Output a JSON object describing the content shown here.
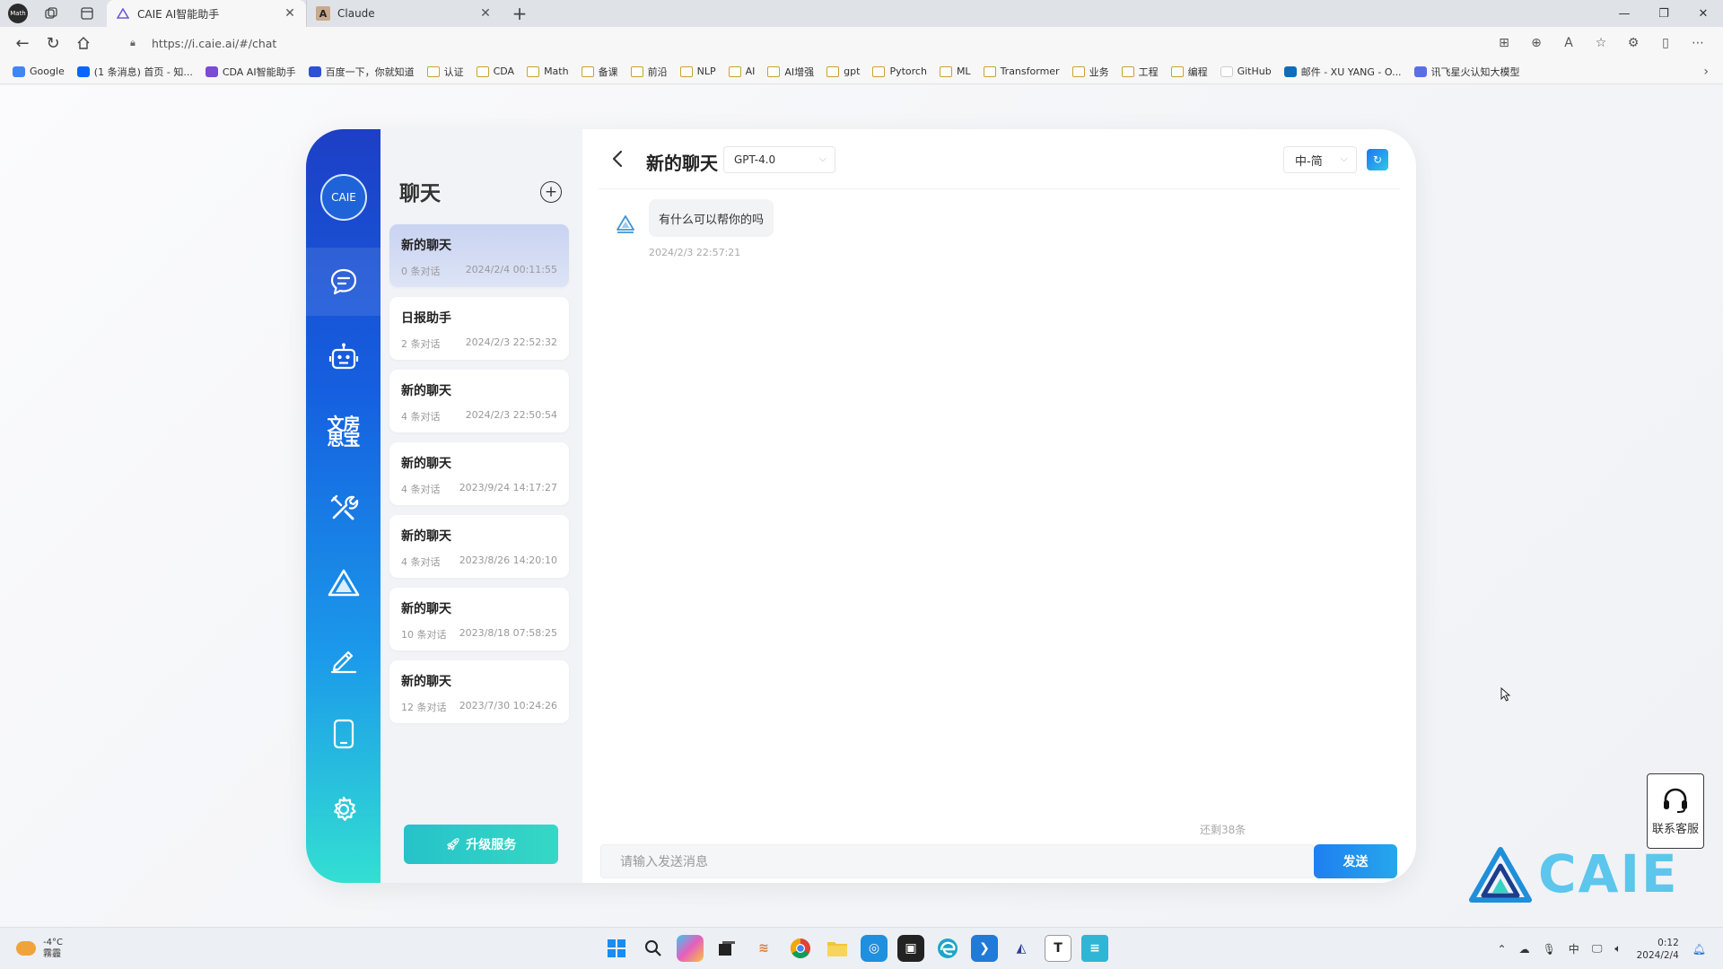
{
  "browser": {
    "profile_label": "Math",
    "tabs": [
      {
        "title": "CAIE AI智能助手",
        "icon": "caie-tab-icon"
      },
      {
        "title": "Claude",
        "icon": "claude-tab-icon"
      }
    ],
    "url": "https://i.caie.ai/#/chat",
    "bookmarks": [
      {
        "label": "Google",
        "type": "site",
        "color": "#4285f4"
      },
      {
        "label": "(1 条消息) 首页 - 知...",
        "type": "site",
        "color": "#0a66ff"
      },
      {
        "label": "CDA AI智能助手",
        "type": "site",
        "color": "#7b4bd6"
      },
      {
        "label": "百度一下，你就知道",
        "type": "site",
        "color": "#2e4fd6"
      },
      {
        "label": "认证",
        "type": "folder"
      },
      {
        "label": "CDA",
        "type": "folder"
      },
      {
        "label": "Math",
        "type": "folder"
      },
      {
        "label": "备课",
        "type": "folder"
      },
      {
        "label": "前沿",
        "type": "folder"
      },
      {
        "label": "NLP",
        "type": "folder"
      },
      {
        "label": "AI",
        "type": "folder"
      },
      {
        "label": "AI增强",
        "type": "folder"
      },
      {
        "label": "gpt",
        "type": "folder"
      },
      {
        "label": "Pytorch",
        "type": "folder"
      },
      {
        "label": "ML",
        "type": "folder"
      },
      {
        "label": "Transformer",
        "type": "folder"
      },
      {
        "label": "业务",
        "type": "folder"
      },
      {
        "label": "工程",
        "type": "folder"
      },
      {
        "label": "编程",
        "type": "folder"
      },
      {
        "label": "GitHub",
        "type": "site",
        "color": "#ffffff"
      },
      {
        "label": "邮件 - XU YANG - O...",
        "type": "site",
        "color": "#0f6cbd"
      },
      {
        "label": "讯飞星火认知大模型",
        "type": "site",
        "color": "#5b6ee8"
      }
    ]
  },
  "rail": {
    "logo_text": "CAIE",
    "text_item": "文房思宝"
  },
  "chatlist": {
    "title": "聊天",
    "items": [
      {
        "title": "新的聊天",
        "count": "0 条对话",
        "date": "2024/2/4 00:11:55"
      },
      {
        "title": "日报助手",
        "count": "2 条对话",
        "date": "2024/2/3 22:52:32"
      },
      {
        "title": "新的聊天",
        "count": "4 条对话",
        "date": "2024/2/3 22:50:54"
      },
      {
        "title": "新的聊天",
        "count": "4 条对话",
        "date": "2023/9/24 14:17:27"
      },
      {
        "title": "新的聊天",
        "count": "4 条对话",
        "date": "2023/8/26 14:20:10"
      },
      {
        "title": "新的聊天",
        "count": "10 条对话",
        "date": "2023/8/18 07:58:25"
      },
      {
        "title": "新的聊天",
        "count": "12 条对话",
        "date": "2023/7/30 10:24:26"
      }
    ],
    "upgrade_label": "升级服务"
  },
  "main": {
    "title": "新的聊天",
    "model": "GPT-4.0",
    "language": "中-简",
    "message": {
      "text": "有什么可以帮你的吗",
      "time": "2024/2/3 22:57:21"
    },
    "remaining": "还剩38条",
    "input_placeholder": "请输入发送消息",
    "send_label": "发送"
  },
  "support_label": "联系客服",
  "brand_text": "CAIE",
  "taskbar": {
    "temperature": "-4°C",
    "weather": "霧霾",
    "ime": "中",
    "time": "0:12",
    "date": "2024/2/4"
  },
  "colors": {
    "accent": "#1f7ff0",
    "teal": "#35d8c5",
    "rail_top": "#1d3fc6",
    "rail_bottom": "#33dfd2"
  }
}
